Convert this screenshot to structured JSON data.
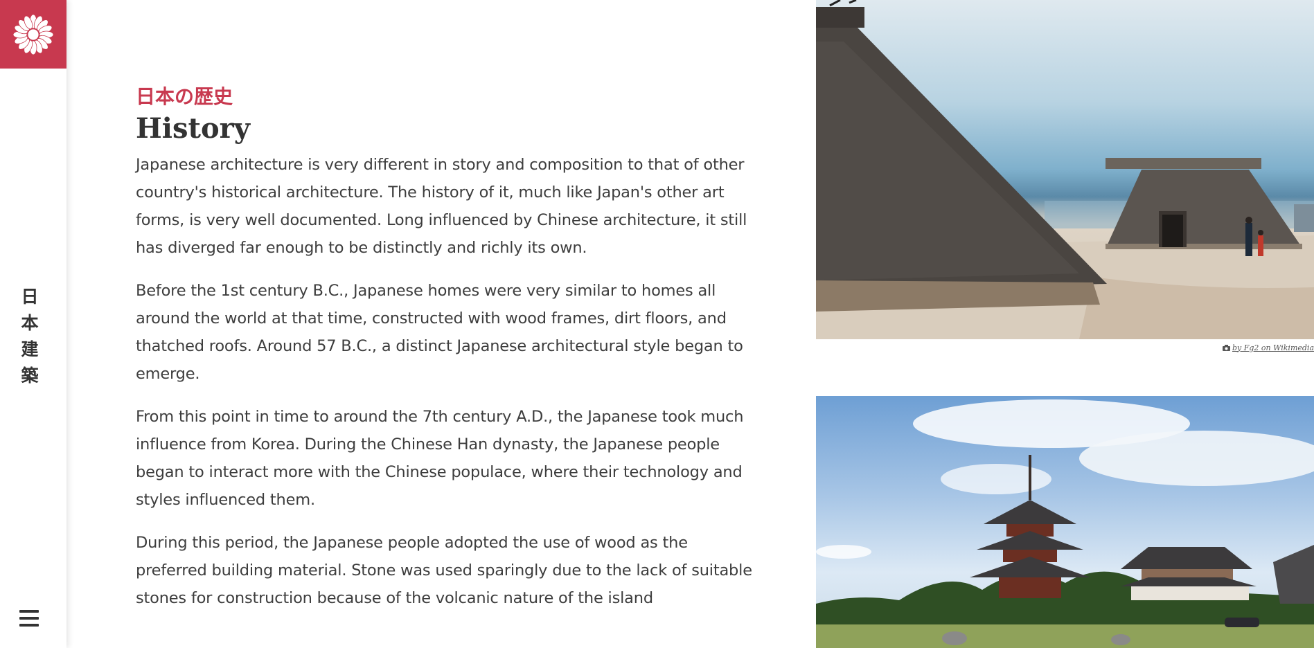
{
  "sidebar": {
    "logo_icon": "chrysanthemum-icon",
    "vertical_title": [
      "日",
      "本",
      "建",
      "築"
    ],
    "menu_icon": "hamburger-menu-icon",
    "accent_color": "#c8394f"
  },
  "article": {
    "subtitle_jp": "日本の歴史",
    "title": "History",
    "paragraphs": [
      "Japanese architecture is very different in story and composition to that of other country's historical architecture. The history of it, much like Japan's other art forms, is very well documented. Long influenced by Chinese architecture, it still has diverged far enough to be distinctly and richly its own.",
      "Before the 1st century B.C., Japanese homes were very similar to homes all around the world at that time, constructed with wood frames, dirt floors, and thatched roofs. Around 57 B.C., a distinct Japanese architectural style began to emerge.",
      "From this point in time to around the 7th century A.D., the Japanese took much influence from Korea. During the Chinese Han dynasty, the Japanese people began to interact more with the Chinese populace, where their technology and styles influenced them.",
      "During this period, the Japanese people adopted the use of wood as the preferred building material. Stone was used sparingly due to the lack of suitable stones for construction because of the volcanic nature of the island"
    ]
  },
  "images": {
    "photo_1_credit": "by Fg2 on Wikimedia",
    "credit_icon": "camera-icon"
  }
}
